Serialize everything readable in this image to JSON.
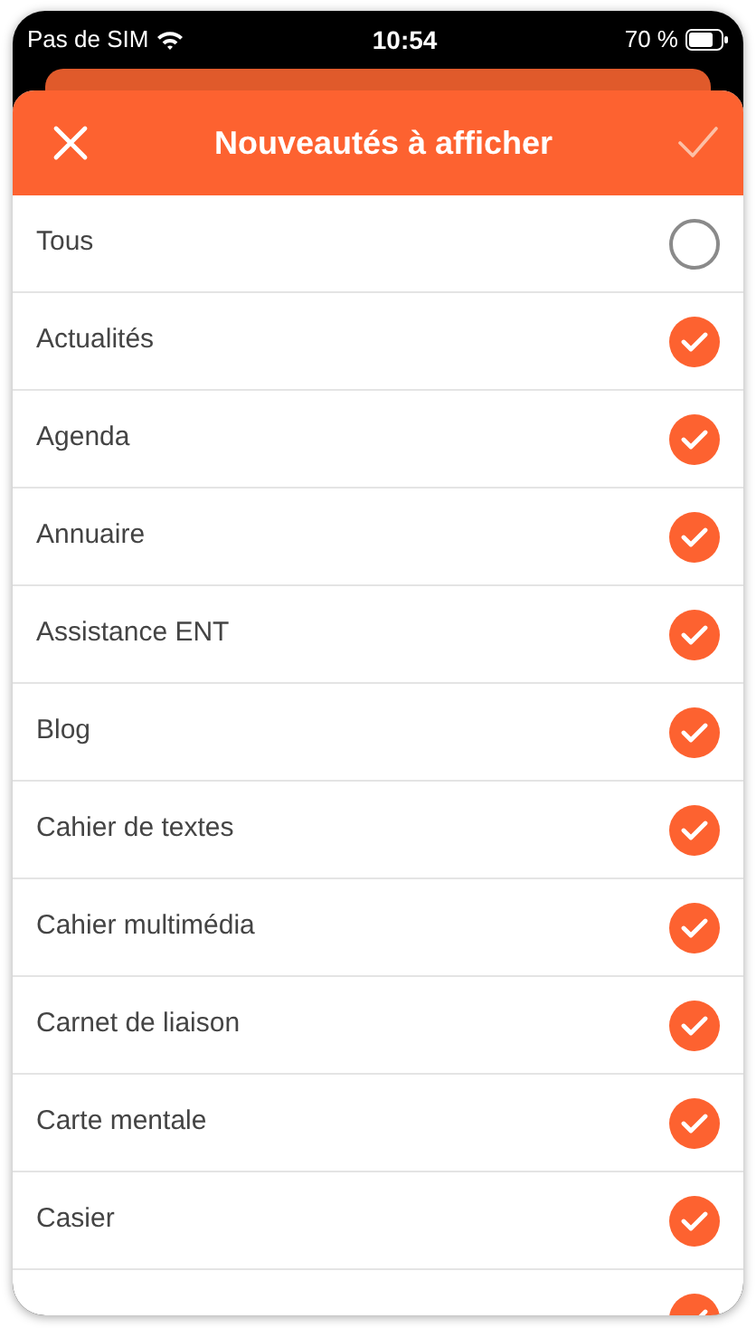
{
  "status_bar": {
    "carrier": "Pas de SIM",
    "time": "10:54",
    "battery": "70 %"
  },
  "header": {
    "title": "Nouveautés à afficher"
  },
  "items": [
    {
      "label": "Tous",
      "checked": false
    },
    {
      "label": "Actualités",
      "checked": true
    },
    {
      "label": "Agenda",
      "checked": true
    },
    {
      "label": "Annuaire",
      "checked": true
    },
    {
      "label": "Assistance ENT",
      "checked": true
    },
    {
      "label": "Blog",
      "checked": true
    },
    {
      "label": "Cahier de textes",
      "checked": true
    },
    {
      "label": "Cahier multimédia",
      "checked": true
    },
    {
      "label": "Carnet de liaison",
      "checked": true
    },
    {
      "label": "Carte mentale",
      "checked": true
    },
    {
      "label": "Casier",
      "checked": true
    },
    {
      "checked": true
    }
  ]
}
